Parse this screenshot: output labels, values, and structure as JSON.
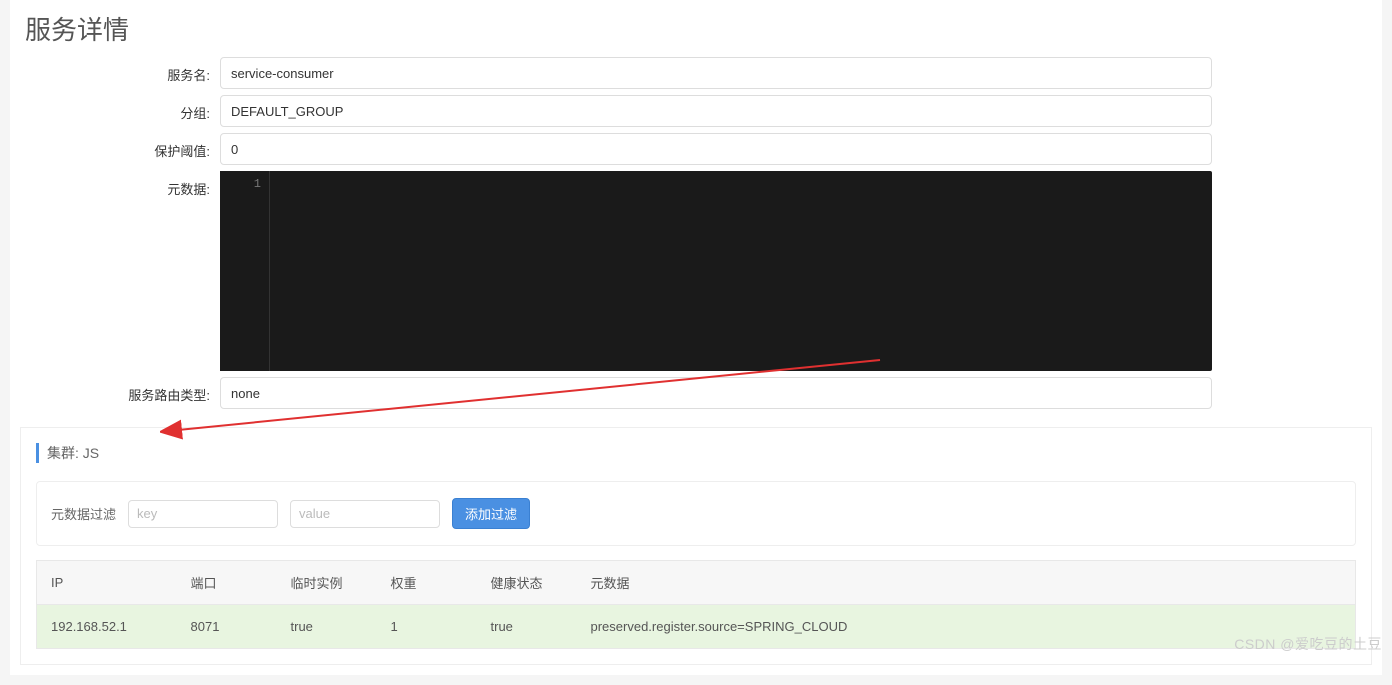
{
  "page_title": "服务详情",
  "form": {
    "service_name": {
      "label": "服务名:",
      "value": "service-consumer"
    },
    "group": {
      "label": "分组:",
      "value": "DEFAULT_GROUP"
    },
    "protect_threshold": {
      "label": "保护阈值:",
      "value": "0"
    },
    "metadata": {
      "label": "元数据:",
      "line_number": "1",
      "content": ""
    },
    "route_type": {
      "label": "服务路由类型:",
      "value": "none"
    }
  },
  "cluster": {
    "title_prefix": "集群:",
    "name": "JS",
    "filter": {
      "label": "元数据过滤",
      "key_placeholder": "key",
      "value_placeholder": "value",
      "button": "添加过滤"
    },
    "table": {
      "headers": {
        "ip": "IP",
        "port": "端口",
        "ephemeral": "临时实例",
        "weight": "权重",
        "health": "健康状态",
        "metadata": "元数据"
      },
      "rows": [
        {
          "ip": "192.168.52.1",
          "port": "8071",
          "ephemeral": "true",
          "weight": "1",
          "health": "true",
          "metadata": "preserved.register.source=SPRING_CLOUD"
        }
      ]
    }
  },
  "watermark": "CSDN @爱吃豆的土豆"
}
